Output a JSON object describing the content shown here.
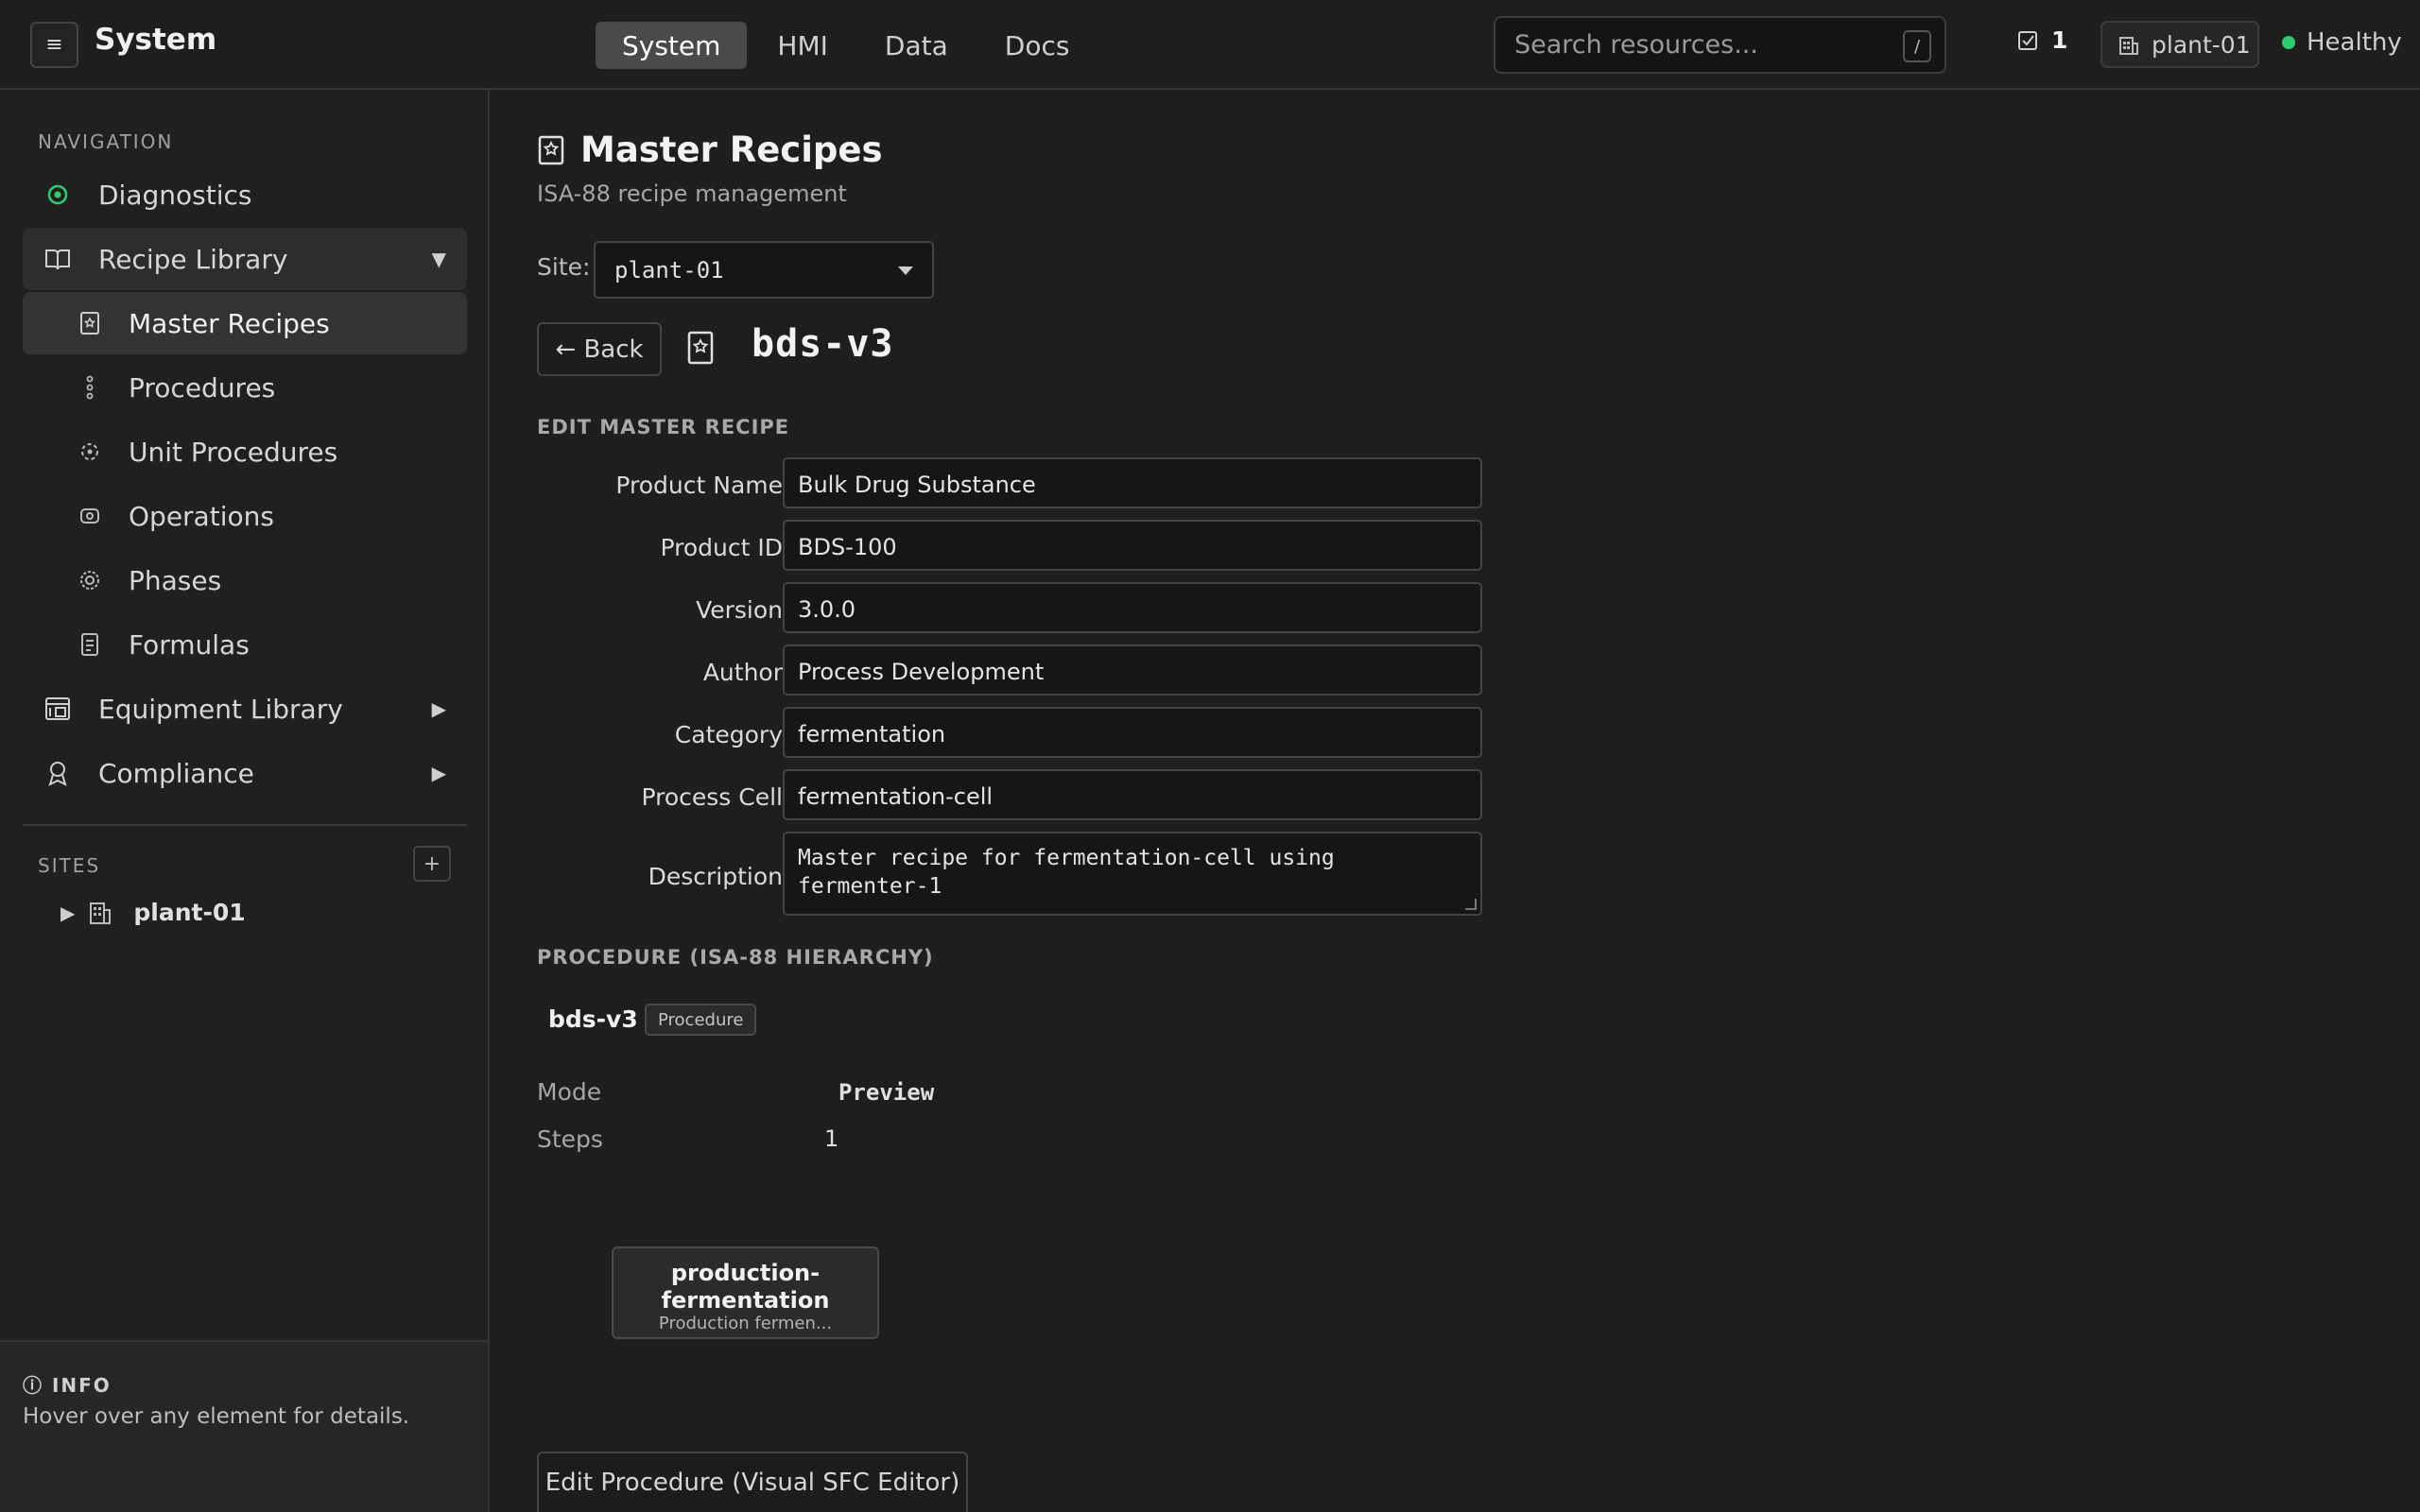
{
  "app": {
    "title": "System"
  },
  "tabs": [
    {
      "label": "System"
    },
    {
      "label": "HMI"
    },
    {
      "label": "Data"
    },
    {
      "label": "Docs"
    }
  ],
  "search": {
    "placeholder": "Search resources...",
    "shortcut": "/"
  },
  "header": {
    "task_count": "1",
    "site": "plant-01",
    "health": "Healthy",
    "health_color": "#2ecc71"
  },
  "sidebar": {
    "nav_label": "NAVIGATION",
    "items": [
      {
        "label": "Diagnostics",
        "icon": "diagnostics-icon"
      },
      {
        "label": "Recipe Library",
        "icon": "book-icon"
      },
      {
        "label": "Master Recipes",
        "icon": "recipe-icon"
      },
      {
        "label": "Procedures",
        "icon": "procedure-icon"
      },
      {
        "label": "Unit Procedures",
        "icon": "unit-procedure-icon"
      },
      {
        "label": "Operations",
        "icon": "operations-icon"
      },
      {
        "label": "Phases",
        "icon": "phases-icon"
      },
      {
        "label": "Formulas",
        "icon": "formulas-icon"
      },
      {
        "label": "Equipment Library",
        "icon": "equipment-icon"
      },
      {
        "label": "Compliance",
        "icon": "compliance-icon"
      }
    ],
    "sites_label": "SITES",
    "add_site_label": "+",
    "sites": [
      {
        "name": "plant-01"
      }
    ],
    "info_title": "INFO",
    "info_text": "Hover over any element for details."
  },
  "page": {
    "title": "Master Recipes",
    "subtitle": "ISA-88 recipe management",
    "site_label": "Site:",
    "site_value": "plant-01",
    "back_label": "← Back",
    "recipe_name": "bds-v3"
  },
  "form": {
    "title": "EDIT MASTER RECIPE",
    "fields": [
      {
        "label": "Product Name",
        "value": "Bulk Drug Substance"
      },
      {
        "label": "Product ID",
        "value": "BDS-100"
      },
      {
        "label": "Version",
        "value": "3.0.0"
      },
      {
        "label": "Author",
        "value": "Process Development"
      },
      {
        "label": "Category",
        "value": "fermentation"
      },
      {
        "label": "Process Cell",
        "value": "fermentation-cell"
      },
      {
        "label": "Description",
        "value": "Master recipe for fermentation-cell using fermenter-1"
      }
    ]
  },
  "procedure": {
    "title": "PROCEDURE (ISA-88 HIERARCHY)",
    "name": "bds-v3",
    "badge": "Procedure",
    "mode_label": "Mode",
    "mode_value": "Preview",
    "steps_label": "Steps",
    "steps_value": "1",
    "step_node": {
      "name": "production-fermentation",
      "desc": "Production fermen..."
    },
    "edit_button": "Edit Procedure (Visual SFC Editor)"
  }
}
